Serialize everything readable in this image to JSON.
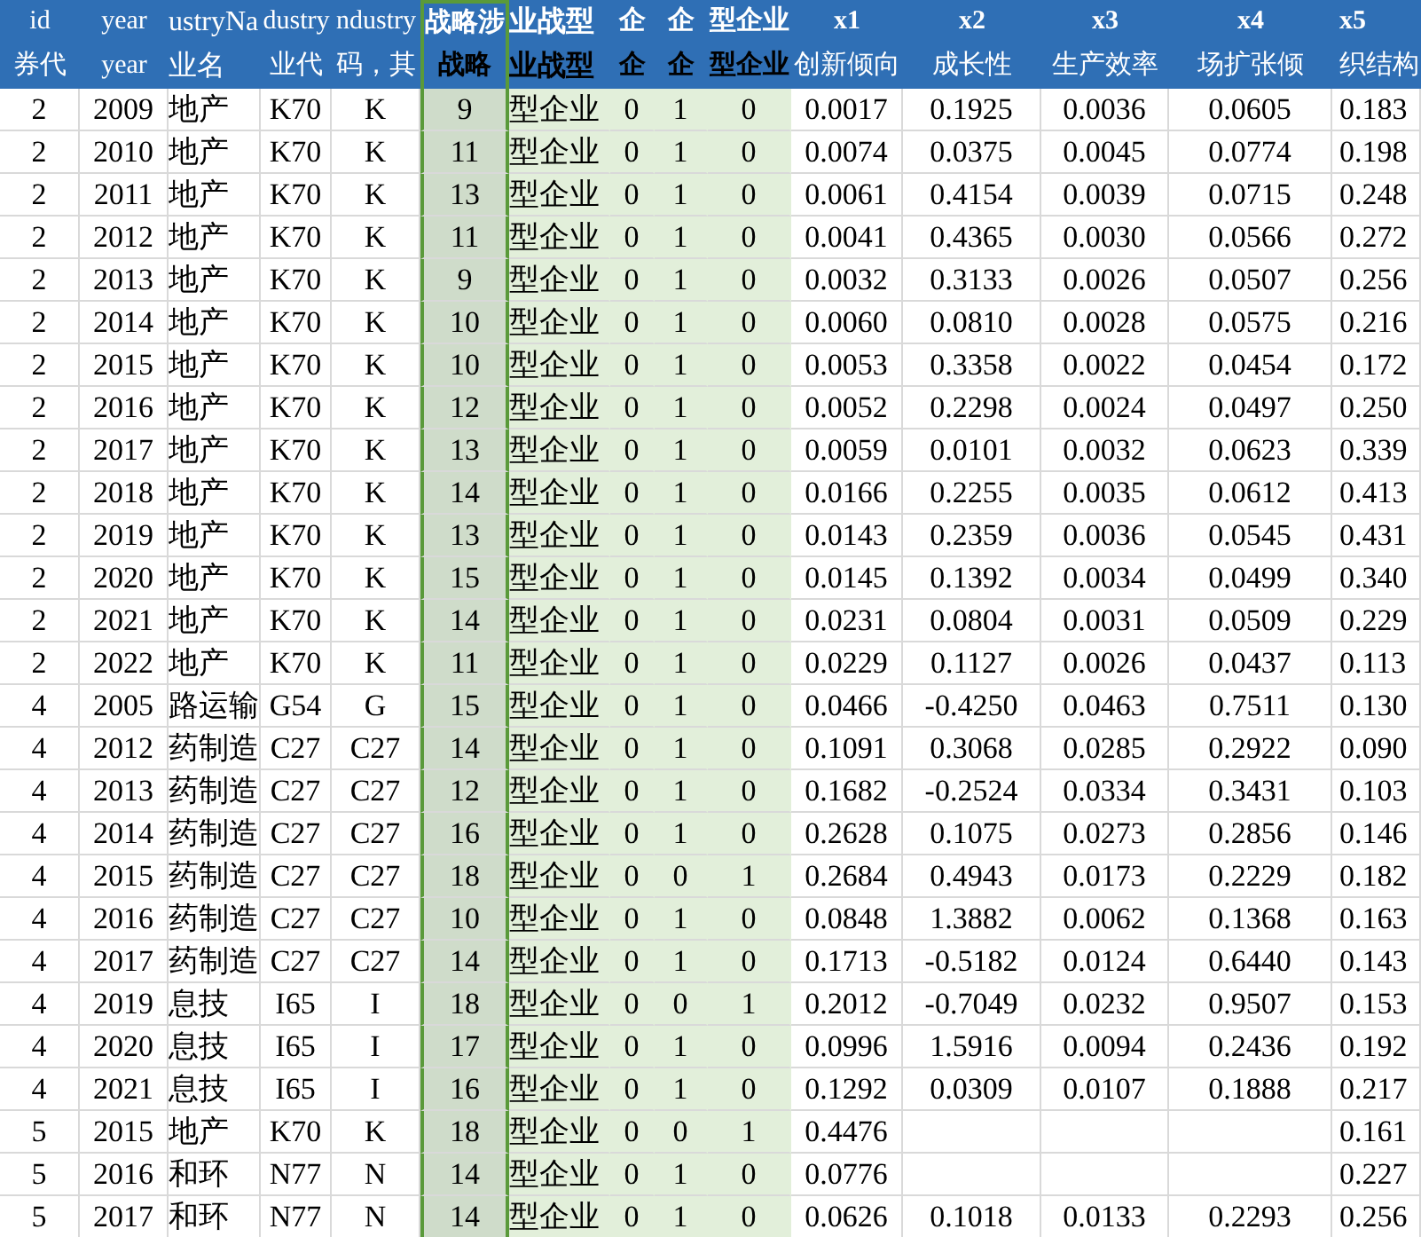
{
  "columns": [
    {
      "title": "id",
      "label": "券代",
      "kind": "number",
      "selected": false,
      "highlighted": false,
      "title_bold": false,
      "label_bold": false
    },
    {
      "title": "year",
      "label": "year",
      "kind": "number",
      "selected": false,
      "highlighted": false,
      "title_bold": false,
      "label_bold": false
    },
    {
      "title": "ustryNa",
      "label": "业名",
      "kind": "text",
      "selected": false,
      "highlighted": false,
      "title_bold": false,
      "label_bold": false
    },
    {
      "title": "dustry",
      "label": "业代",
      "kind": "number",
      "selected": false,
      "highlighted": false,
      "title_bold": false,
      "label_bold": false
    },
    {
      "title": "ndustry",
      "label": "码，其",
      "kind": "number",
      "selected": false,
      "highlighted": false,
      "title_bold": false,
      "label_bold": false
    },
    {
      "title": "战略涉",
      "label": "战略",
      "kind": "number",
      "selected": true,
      "highlighted": false,
      "title_bold": true,
      "label_bold": true
    },
    {
      "title": "业战型",
      "label": "业战型",
      "kind": "text",
      "selected": false,
      "highlighted": true,
      "title_bold": true,
      "label_bold": true
    },
    {
      "title": "企",
      "label": "企",
      "kind": "number",
      "selected": false,
      "highlighted": true,
      "title_bold": true,
      "label_bold": true
    },
    {
      "title": "企",
      "label": "企",
      "kind": "number",
      "selected": false,
      "highlighted": true,
      "title_bold": true,
      "label_bold": true
    },
    {
      "title": "型企业",
      "label": "型企业",
      "kind": "number",
      "selected": false,
      "highlighted": true,
      "title_bold": true,
      "label_bold": true
    },
    {
      "title": "x1",
      "label": "创新倾向",
      "kind": "number",
      "selected": false,
      "highlighted": false,
      "title_bold": true,
      "label_bold": false
    },
    {
      "title": "x2",
      "label": "成长性",
      "kind": "number",
      "selected": false,
      "highlighted": false,
      "title_bold": true,
      "label_bold": false
    },
    {
      "title": "x3",
      "label": "生产效率",
      "kind": "number",
      "selected": false,
      "highlighted": false,
      "title_bold": true,
      "label_bold": false
    },
    {
      "title": "x4",
      "label": "场扩张倾",
      "kind": "number",
      "selected": false,
      "highlighted": false,
      "title_bold": true,
      "label_bold": false
    },
    {
      "title": "x5",
      "label": "织结构",
      "kind": "edge",
      "selected": false,
      "highlighted": false,
      "title_bold": true,
      "label_bold": false
    }
  ],
  "rows": [
    [
      "2",
      "2009",
      "地产",
      "K70",
      "K",
      "9",
      "型企业",
      "0",
      "1",
      "0",
      "0.0017",
      "0.1925",
      "0.0036",
      "0.0605",
      "0.183"
    ],
    [
      "2",
      "2010",
      "地产",
      "K70",
      "K",
      "11",
      "型企业",
      "0",
      "1",
      "0",
      "0.0074",
      "0.0375",
      "0.0045",
      "0.0774",
      "0.198"
    ],
    [
      "2",
      "2011",
      "地产",
      "K70",
      "K",
      "13",
      "型企业",
      "0",
      "1",
      "0",
      "0.0061",
      "0.4154",
      "0.0039",
      "0.0715",
      "0.248"
    ],
    [
      "2",
      "2012",
      "地产",
      "K70",
      "K",
      "11",
      "型企业",
      "0",
      "1",
      "0",
      "0.0041",
      "0.4365",
      "0.0030",
      "0.0566",
      "0.272"
    ],
    [
      "2",
      "2013",
      "地产",
      "K70",
      "K",
      "9",
      "型企业",
      "0",
      "1",
      "0",
      "0.0032",
      "0.3133",
      "0.0026",
      "0.0507",
      "0.256"
    ],
    [
      "2",
      "2014",
      "地产",
      "K70",
      "K",
      "10",
      "型企业",
      "0",
      "1",
      "0",
      "0.0060",
      "0.0810",
      "0.0028",
      "0.0575",
      "0.216"
    ],
    [
      "2",
      "2015",
      "地产",
      "K70",
      "K",
      "10",
      "型企业",
      "0",
      "1",
      "0",
      "0.0053",
      "0.3358",
      "0.0022",
      "0.0454",
      "0.172"
    ],
    [
      "2",
      "2016",
      "地产",
      "K70",
      "K",
      "12",
      "型企业",
      "0",
      "1",
      "0",
      "0.0052",
      "0.2298",
      "0.0024",
      "0.0497",
      "0.250"
    ],
    [
      "2",
      "2017",
      "地产",
      "K70",
      "K",
      "13",
      "型企业",
      "0",
      "1",
      "0",
      "0.0059",
      "0.0101",
      "0.0032",
      "0.0623",
      "0.339"
    ],
    [
      "2",
      "2018",
      "地产",
      "K70",
      "K",
      "14",
      "型企业",
      "0",
      "1",
      "0",
      "0.0166",
      "0.2255",
      "0.0035",
      "0.0612",
      "0.413"
    ],
    [
      "2",
      "2019",
      "地产",
      "K70",
      "K",
      "13",
      "型企业",
      "0",
      "1",
      "0",
      "0.0143",
      "0.2359",
      "0.0036",
      "0.0545",
      "0.431"
    ],
    [
      "2",
      "2020",
      "地产",
      "K70",
      "K",
      "15",
      "型企业",
      "0",
      "1",
      "0",
      "0.0145",
      "0.1392",
      "0.0034",
      "0.0499",
      "0.340"
    ],
    [
      "2",
      "2021",
      "地产",
      "K70",
      "K",
      "14",
      "型企业",
      "0",
      "1",
      "0",
      "0.0231",
      "0.0804",
      "0.0031",
      "0.0509",
      "0.229"
    ],
    [
      "2",
      "2022",
      "地产",
      "K70",
      "K",
      "11",
      "型企业",
      "0",
      "1",
      "0",
      "0.0229",
      "0.1127",
      "0.0026",
      "0.0437",
      "0.113"
    ],
    [
      "4",
      "2005",
      "路运输",
      "G54",
      "G",
      "15",
      "型企业",
      "0",
      "1",
      "0",
      "0.0466",
      "-0.4250",
      "0.0463",
      "0.7511",
      "0.130"
    ],
    [
      "4",
      "2012",
      "药制造",
      "C27",
      "C27",
      "14",
      "型企业",
      "0",
      "1",
      "0",
      "0.1091",
      "0.3068",
      "0.0285",
      "0.2922",
      "0.090"
    ],
    [
      "4",
      "2013",
      "药制造",
      "C27",
      "C27",
      "12",
      "型企业",
      "0",
      "1",
      "0",
      "0.1682",
      "-0.2524",
      "0.0334",
      "0.3431",
      "0.103"
    ],
    [
      "4",
      "2014",
      "药制造",
      "C27",
      "C27",
      "16",
      "型企业",
      "0",
      "1",
      "0",
      "0.2628",
      "0.1075",
      "0.0273",
      "0.2856",
      "0.146"
    ],
    [
      "4",
      "2015",
      "药制造",
      "C27",
      "C27",
      "18",
      "型企业",
      "0",
      "0",
      "1",
      "0.2684",
      "0.4943",
      "0.0173",
      "0.2229",
      "0.182"
    ],
    [
      "4",
      "2016",
      "药制造",
      "C27",
      "C27",
      "10",
      "型企业",
      "0",
      "1",
      "0",
      "0.0848",
      "1.3882",
      "0.0062",
      "0.1368",
      "0.163"
    ],
    [
      "4",
      "2017",
      "药制造",
      "C27",
      "C27",
      "14",
      "型企业",
      "0",
      "1",
      "0",
      "0.1713",
      "-0.5182",
      "0.0124",
      "0.6440",
      "0.143"
    ],
    [
      "4",
      "2019",
      "息技",
      "I65",
      "I",
      "18",
      "型企业",
      "0",
      "0",
      "1",
      "0.2012",
      "-0.7049",
      "0.0232",
      "0.9507",
      "0.153"
    ],
    [
      "4",
      "2020",
      "息技",
      "I65",
      "I",
      "17",
      "型企业",
      "0",
      "1",
      "0",
      "0.0996",
      "1.5916",
      "0.0094",
      "0.2436",
      "0.192"
    ],
    [
      "4",
      "2021",
      "息技",
      "I65",
      "I",
      "16",
      "型企业",
      "0",
      "1",
      "0",
      "0.1292",
      "0.0309",
      "0.0107",
      "0.1888",
      "0.217"
    ],
    [
      "5",
      "2015",
      "地产",
      "K70",
      "K",
      "18",
      "型企业",
      "0",
      "0",
      "1",
      "0.4476",
      null,
      null,
      null,
      "0.161"
    ],
    [
      "5",
      "2016",
      "和环",
      "N77",
      "N",
      "14",
      "型企业",
      "0",
      "1",
      "0",
      "0.0776",
      null,
      null,
      null,
      "0.227"
    ],
    [
      "5",
      "2017",
      "和环",
      "N77",
      "N",
      "14",
      "型企业",
      "0",
      "1",
      "0",
      "0.0626",
      "0.1018",
      "0.0133",
      "0.2293",
      "0.256"
    ]
  ]
}
